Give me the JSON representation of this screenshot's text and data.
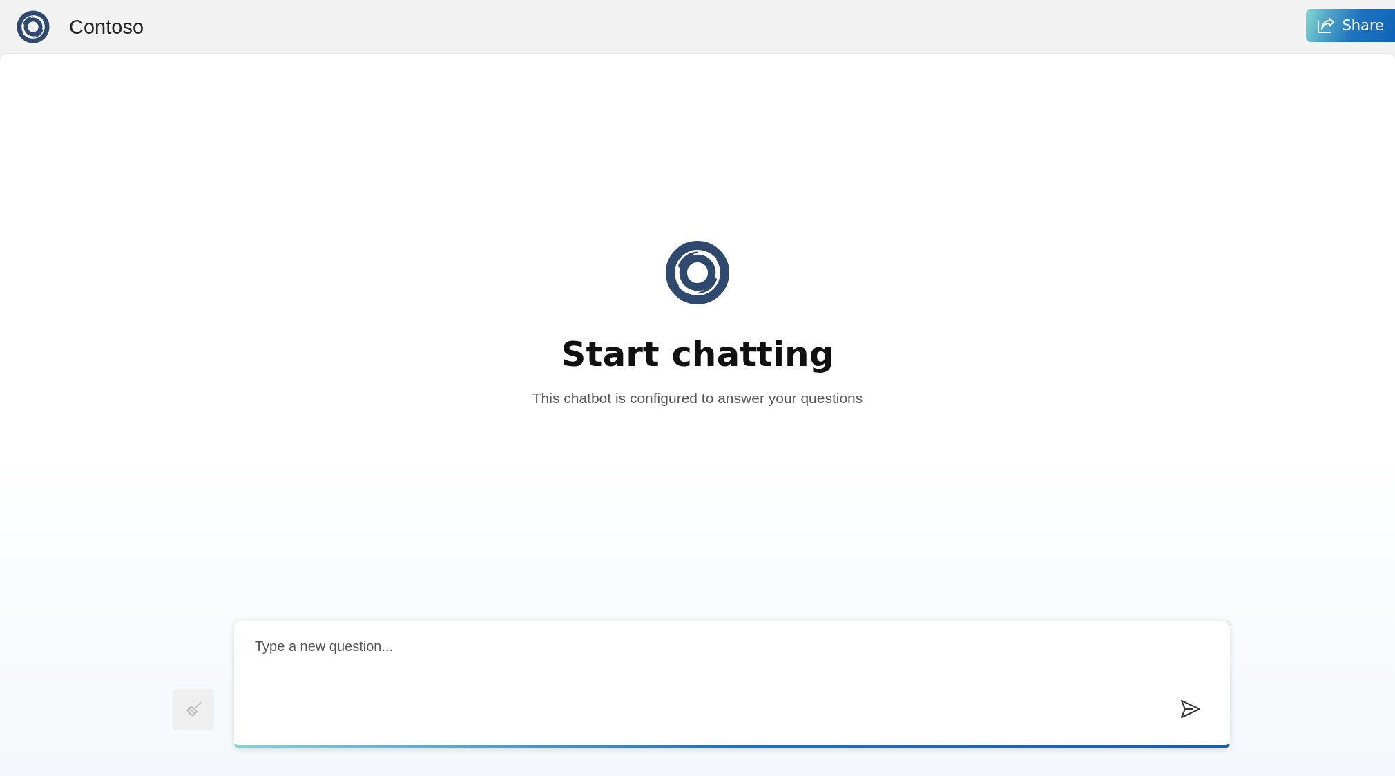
{
  "header": {
    "title": "Contoso",
    "share_button": "Share"
  },
  "hero": {
    "title": "Start chatting",
    "subtitle": "This chatbot is configured to answer your questions"
  },
  "composer": {
    "placeholder": "Type a new question...",
    "clear_button": {
      "disabled": true
    }
  }
}
